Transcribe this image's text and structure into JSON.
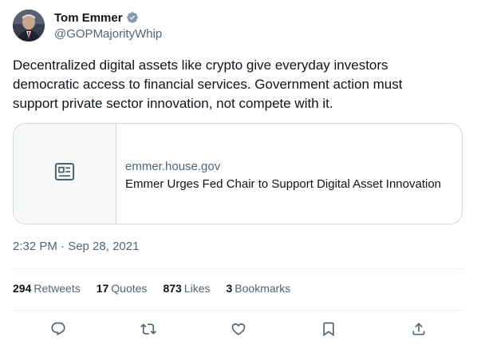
{
  "author": {
    "display_name": "Tom Emmer",
    "handle": "@GOPMajorityWhip",
    "verified": true,
    "verified_color": "#829aab"
  },
  "tweet": {
    "text": "Decentralized digital assets like crypto give everyday investors democratic access to financial services. Government action must support private sector innovation, not compete with it.",
    "timestamp": "2:32 PM · Sep 28, 2021"
  },
  "card": {
    "icon": "news-article-icon",
    "domain": "emmer.house.gov",
    "title": "Emmer Urges Fed Chair to Support Digital Asset Innovation"
  },
  "stats": [
    {
      "count": "294",
      "label": "Retweets"
    },
    {
      "count": "17",
      "label": "Quotes"
    },
    {
      "count": "873",
      "label": "Likes"
    },
    {
      "count": "3",
      "label": "Bookmarks"
    }
  ],
  "actions": [
    {
      "icon": "reply-icon"
    },
    {
      "icon": "retweet-icon"
    },
    {
      "icon": "like-icon"
    },
    {
      "icon": "bookmark-icon"
    },
    {
      "icon": "share-icon"
    }
  ],
  "colors": {
    "text_primary": "#0f1419",
    "text_secondary": "#536471",
    "border": "#cfd9de",
    "divider": "#eff3f4"
  }
}
